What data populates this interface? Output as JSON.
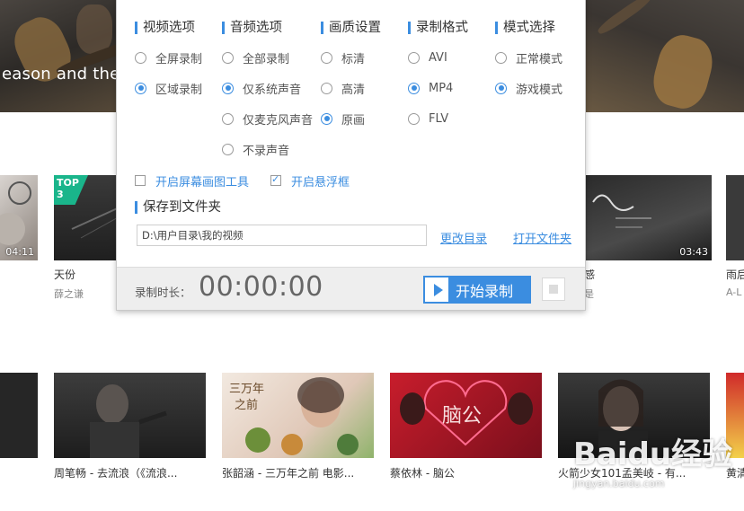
{
  "background": {
    "banner_text": "eason and the",
    "row1": [
      {
        "duration": "04:11"
      },
      {
        "badge_top": "TOP",
        "badge_rank": "3",
        "title": "天份",
        "artist": "薛之谦"
      },
      {
        "duration": "03:43",
        "title": "感",
        "artist": "是"
      },
      {
        "title": "雨后",
        "artist": "A-L"
      }
    ],
    "row2": [
      {
        "title": "周笔畅 - 去流浪（《流浪..."
      },
      {
        "title": "张韶涵 - 三万年之前 电影..."
      },
      {
        "title": "蔡依林 - 脑公"
      },
      {
        "title": "火箭少女101孟美岐 - 有..."
      },
      {
        "title": "黄清"
      }
    ],
    "watermark_logo": "Baidu经验",
    "watermark_url": "jingyan.baidu.com"
  },
  "dialog": {
    "video": {
      "heading": "视频选项",
      "options": [
        {
          "label": "全屏录制",
          "selected": false
        },
        {
          "label": "区域录制",
          "selected": true
        }
      ]
    },
    "audio": {
      "heading": "音频选项",
      "options": [
        {
          "label": "全部录制",
          "selected": false
        },
        {
          "label": "仅系统声音",
          "selected": true
        },
        {
          "label": "仅麦克风声音",
          "selected": false
        },
        {
          "label": "不录声音",
          "selected": false
        }
      ]
    },
    "quality": {
      "heading": "画质设置",
      "options": [
        {
          "label": "标清",
          "selected": false
        },
        {
          "label": "高清",
          "selected": false
        },
        {
          "label": "原画",
          "selected": true
        }
      ]
    },
    "format": {
      "heading": "录制格式",
      "options": [
        {
          "label": "AVI",
          "selected": false
        },
        {
          "label": "MP4",
          "selected": true
        },
        {
          "label": "FLV",
          "selected": false
        }
      ]
    },
    "mode": {
      "heading": "模式选择",
      "options": [
        {
          "label": "正常模式",
          "selected": false
        },
        {
          "label": "游戏模式",
          "selected": true
        }
      ]
    },
    "checkboxes": [
      {
        "label": "开启屏幕画图工具",
        "checked": false
      },
      {
        "label": "开启悬浮框",
        "checked": true
      }
    ],
    "save": {
      "heading": "保存到文件夹",
      "path": "D:\\用户目录\\我的视频",
      "change_dir": "更改目录",
      "open_folder": "打开文件夹"
    },
    "footer": {
      "duration_label": "录制时长：",
      "timer": "00:00:00",
      "start_label": "开始录制"
    },
    "accent_color": "#3b8de0"
  }
}
